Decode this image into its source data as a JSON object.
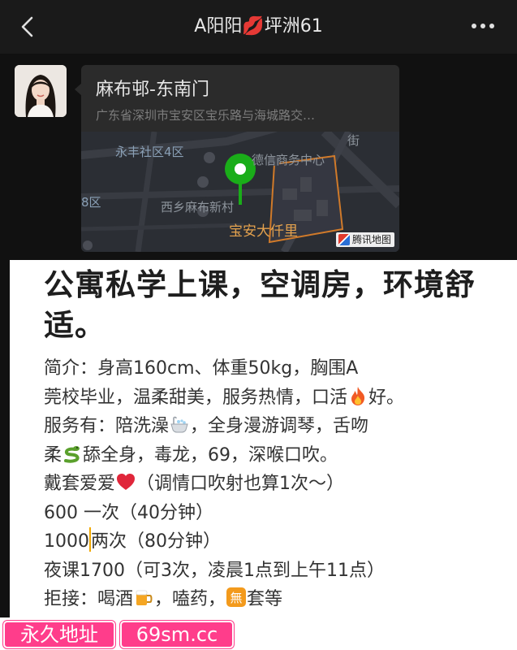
{
  "nav": {
    "title": "A阳阳💋坪洲61",
    "back_icon": "chevron-left-icon",
    "more_icon": "more-dots-icon"
  },
  "message": {
    "location_name": "麻布邨-东南门",
    "location_address": "广东省深圳市宝安区宝乐路与海城路交…",
    "map": {
      "labels": {
        "community": "永丰社区4区",
        "business": "德信商务中心",
        "village": "西乡麻布新村",
        "district": "8区",
        "landmark": "宝安大仟里",
        "street": "街"
      },
      "provider": "腾讯地图",
      "pin_color": "#1aad19"
    }
  },
  "ad": {
    "headline": "公寓私学上课，空调房，环境舒适。",
    "lines": [
      "简介：身高160cm、体重50kg，胸围A",
      "莞校毕业，温柔甜美，服务热情，口活",
      "好。",
      "服务有：陪洗澡",
      "，全身漫游调琴，舌吻",
      "柔",
      "舔全身，毒龙，69，深喉口吹。",
      "戴套爱爱",
      "（调情口吹射也算1次～）",
      "600 一次（40分钟）",
      "1000",
      "两次（80分钟）",
      "夜课1700（可3次，凌晨1点到上午11点）",
      "拒接：喝酒",
      "，嗑药，",
      "套等"
    ]
  },
  "footer": {
    "badge_left": "永久地址",
    "badge_right": "69sm.cc",
    "badge_color": "#ff3d8b"
  }
}
